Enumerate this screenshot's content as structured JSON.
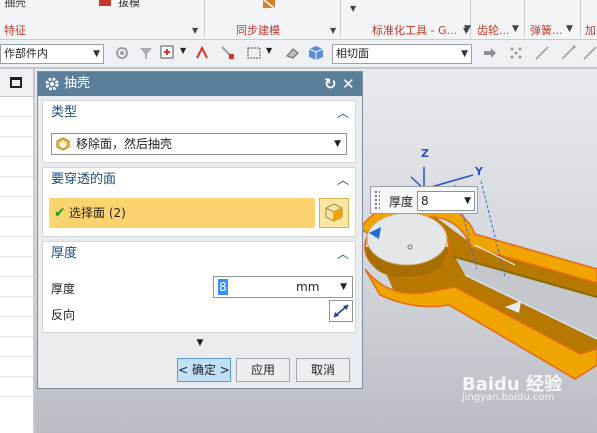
{
  "ribbon": {
    "top_labels": [
      "抽壳",
      "拔模"
    ],
    "groups": [
      "特征",
      "同步建模",
      "标准化工具 - G...",
      "齿轮...",
      "弹簧...",
      "加"
    ]
  },
  "toolbar": {
    "selection_scope": "作部件内",
    "snap_filter": "相切面"
  },
  "dialog": {
    "title": "抽壳",
    "type_section": {
      "header": "类型",
      "value": "移除面，然后抽壳"
    },
    "face_section": {
      "header": "要穿透的面",
      "selection": "选择面 (2)"
    },
    "thickness_section": {
      "header": "厚度",
      "thickness_label": "厚度",
      "thickness_value": "8",
      "unit": "mm",
      "reverse_label": "反向"
    },
    "buttons": {
      "ok": "< 确定 >",
      "apply": "应用",
      "cancel": "取消"
    }
  },
  "viewport": {
    "float_label": "厚度",
    "float_value": "8",
    "axes": {
      "z": "Z",
      "y": "Y"
    },
    "watermark": "Baidu 经验",
    "watermark_url": "jingyan.baidu.com"
  },
  "colors": {
    "title_bar": "#5b7f9b",
    "section_header": "#1f4e79",
    "selection_highlight": "#fcd36e",
    "model_orange": "#f0a400"
  }
}
